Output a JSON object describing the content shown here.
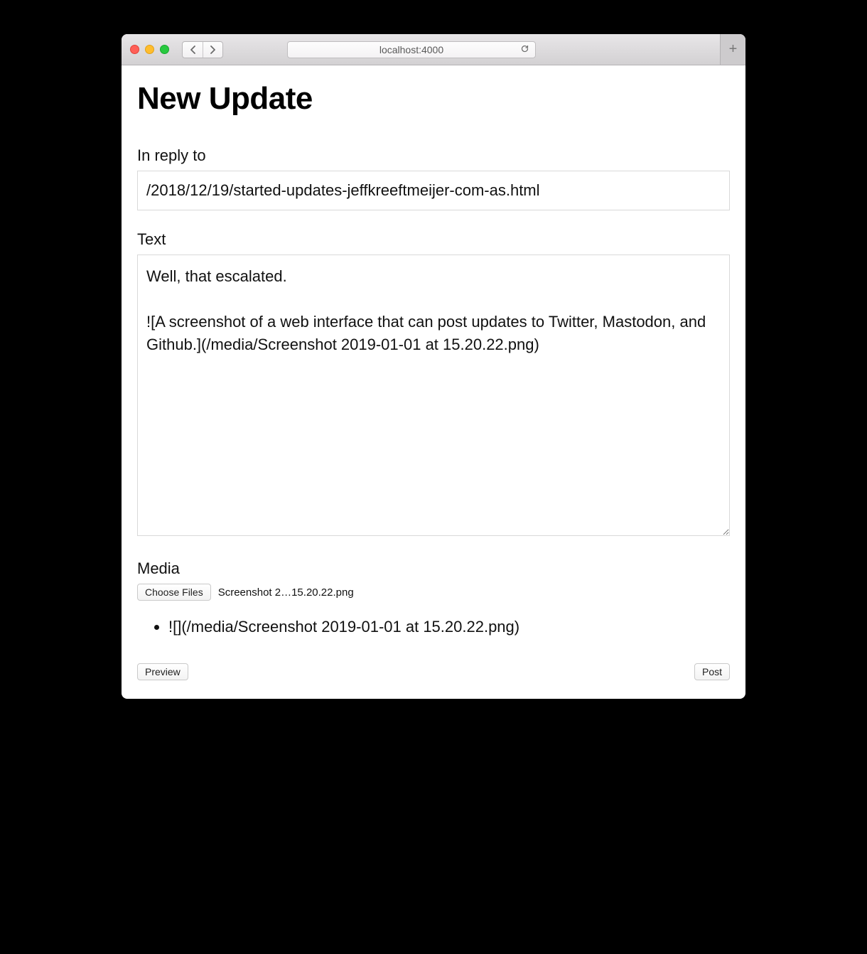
{
  "browser": {
    "address": "localhost:4000"
  },
  "page": {
    "title": "New Update"
  },
  "form": {
    "reply_label": "In reply to",
    "reply_value": "/2018/12/19/started-updates-jeffkreeftmeijer-com-as.html",
    "text_label": "Text",
    "text_value": "Well, that escalated.\n\n![A screenshot of a web interface that can post updates to Twitter, Mastodon, and Github.](/media/Screenshot 2019-01-01 at 15.20.22.png)",
    "media_label": "Media",
    "choose_files_label": "Choose Files",
    "chosen_file_display": "Screenshot 2…15.20.22.png",
    "media_items": [
      "![](/media/Screenshot 2019-01-01 at 15.20.22.png)"
    ],
    "preview_label": "Preview",
    "post_label": "Post"
  }
}
